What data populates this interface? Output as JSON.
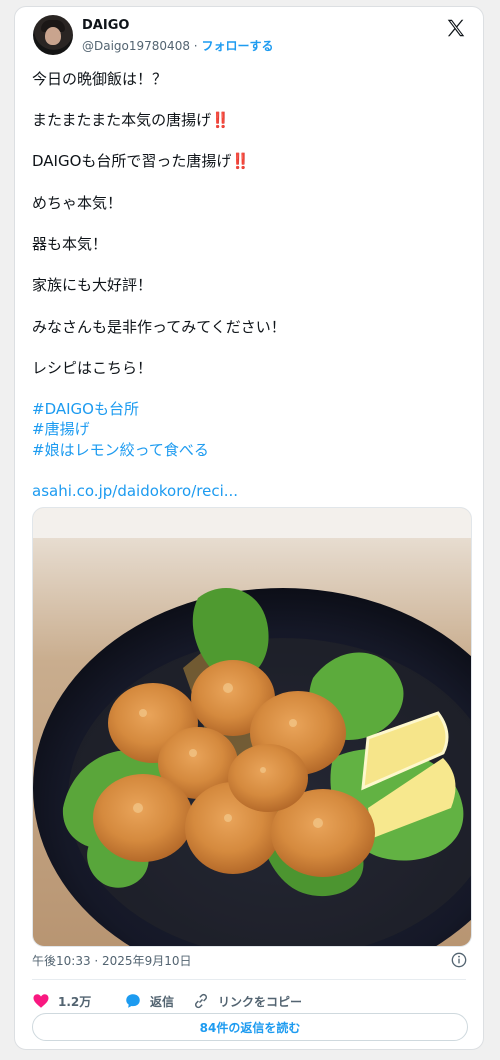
{
  "user": {
    "name": "DAIGO",
    "handle": "@Daigo19780408",
    "separator": "·",
    "follow_label": "フォローする"
  },
  "brand_icon": "x-logo-icon",
  "tweet": {
    "lines": [
      "今日の晩御飯は！？",
      "またまたまた本気の唐揚げ",
      "DAIGOも台所で習った唐揚げ",
      "めちゃ本気！",
      "器も本気！",
      "家族にも大好評！",
      "みなさんも是非作ってみてください！",
      "レシピはこちら！"
    ],
    "emphasis": "‼️",
    "hashtags": [
      "#DAIGOも台所",
      "#唐揚げ",
      "#娘はレモン絞って食べる"
    ],
    "link": "asahi.co.jp/daidokoro/reci..."
  },
  "timestamp": "午後10:33 · 2025年9月10日",
  "actions": {
    "like_count": "1.2万",
    "reply_label": "返信",
    "copy_link_label": "リンクをコピー"
  },
  "read_replies_label": "84件の返信を読む",
  "colors": {
    "accent": "#1d9bf0",
    "like": "#f91880",
    "text": "#0f1419",
    "muted": "#536471"
  }
}
